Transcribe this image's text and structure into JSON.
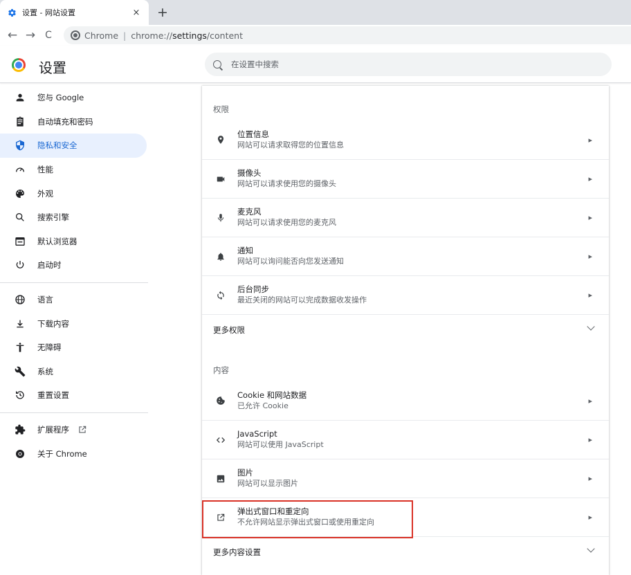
{
  "tab": {
    "title": "设置 - 网站设置",
    "close": "×",
    "new_tab": "+"
  },
  "toolbar": {
    "back": "←",
    "forward": "→",
    "reload": "C",
    "site_label": "Chrome",
    "url_dim": "chrome://",
    "url_host": "settings",
    "url_path": "/content"
  },
  "header": {
    "title": "设置",
    "search_placeholder": "在设置中搜索"
  },
  "sidebar": {
    "items": [
      {
        "label": "您与 Google",
        "icon": "person-icon"
      },
      {
        "label": "自动填充和密码",
        "icon": "clipboard-icon"
      },
      {
        "label": "隐私和安全",
        "icon": "shield-icon",
        "active": true
      },
      {
        "label": "性能",
        "icon": "speedometer-icon"
      },
      {
        "label": "外观",
        "icon": "palette-icon"
      },
      {
        "label": "搜索引擎",
        "icon": "search-icon"
      },
      {
        "label": "默认浏览器",
        "icon": "browser-icon"
      },
      {
        "label": "启动时",
        "icon": "power-icon"
      },
      {
        "label": "语言",
        "icon": "globe-icon"
      },
      {
        "label": "下载内容",
        "icon": "download-icon"
      },
      {
        "label": "无障碍",
        "icon": "accessibility-icon"
      },
      {
        "label": "系统",
        "icon": "wrench-icon"
      },
      {
        "label": "重置设置",
        "icon": "reset-icon"
      },
      {
        "label": "扩展程序",
        "icon": "puzzle-icon"
      },
      {
        "label": "关于 Chrome",
        "icon": "chrome-icon"
      }
    ]
  },
  "main": {
    "permissions_label": "权限",
    "permissions": [
      {
        "title": "位置信息",
        "sub": "网站可以请求取得您的位置信息",
        "icon": "location-pin-icon"
      },
      {
        "title": "摄像头",
        "sub": "网站可以请求使用您的摄像头",
        "icon": "camera-icon"
      },
      {
        "title": "麦克风",
        "sub": "网站可以请求使用您的麦克风",
        "icon": "microphone-icon"
      },
      {
        "title": "通知",
        "sub": "网站可以询问能否向您发送通知",
        "icon": "bell-icon"
      },
      {
        "title": "后台同步",
        "sub": "最近关闭的网站可以完成数据收发操作",
        "icon": "sync-icon"
      }
    ],
    "more_permissions": "更多权限",
    "content_label": "内容",
    "content": [
      {
        "title": "Cookie 和网站数据",
        "sub": "已允许 Cookie",
        "icon": "cookie-icon"
      },
      {
        "title": "JavaScript",
        "sub": "网站可以使用 JavaScript",
        "icon": "code-icon"
      },
      {
        "title": "图片",
        "sub": "网站可以显示图片",
        "icon": "image-icon"
      },
      {
        "title": "弹出式窗口和重定向",
        "sub": "不允许网站显示弹出式窗口或使用重定向",
        "icon": "popup-icon"
      }
    ],
    "more_content": "更多内容设置"
  },
  "colors": {
    "accent": "#1967d2",
    "active_bg": "#e8f0fe",
    "highlight": "#d93025"
  }
}
